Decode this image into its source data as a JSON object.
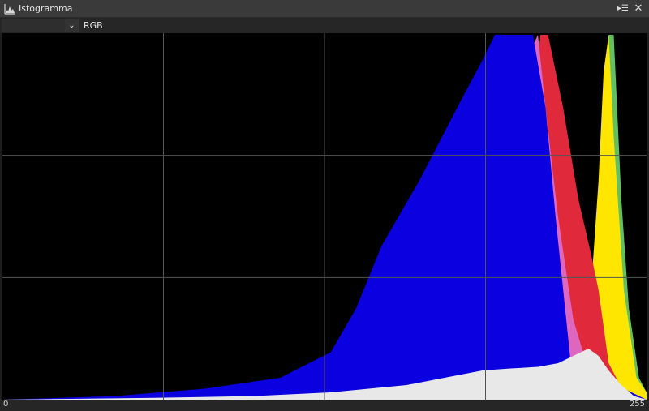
{
  "window": {
    "title": "Istogramma",
    "icon": "histogram-icon",
    "menu_icon": "panel-menu-icon",
    "close_icon": "close-icon"
  },
  "toolbar": {
    "dropdown_icon": "chevron-down-icon",
    "channel_label": "RGB"
  },
  "axis": {
    "min_label": "0",
    "max_label": "255"
  },
  "colors": {
    "background": "#000000",
    "grid": "#555555",
    "blue": "#0a00e0",
    "magenta": "#de66be",
    "red": "#e02a3c",
    "yellow": "#ffe600",
    "green": "#62bf62",
    "cyan": "#22c0e0",
    "luminance": "#e8e8e8"
  },
  "chart_data": {
    "type": "area",
    "x_range": [
      0,
      255
    ],
    "y_range": [
      0,
      1
    ],
    "grid": true,
    "grid_divisions": {
      "x": 4,
      "y": 3
    },
    "legend": "none",
    "series": [
      {
        "color_key": "green",
        "x": [
          0,
          230,
          235,
          238,
          240,
          242,
          245,
          248,
          252,
          255
        ],
        "values": [
          0,
          0,
          0.4,
          0.8,
          1.0,
          1.0,
          0.55,
          0.25,
          0.06,
          0.02
        ]
      },
      {
        "color_key": "yellow",
        "x": [
          0,
          223,
          228,
          233,
          236,
          238,
          240,
          242,
          246,
          251,
          255
        ],
        "values": [
          0,
          0,
          0.1,
          0.3,
          0.6,
          0.9,
          1.0,
          0.72,
          0.3,
          0.06,
          0.02
        ]
      },
      {
        "color_key": "red",
        "x": [
          0,
          195,
          205,
          210,
          213,
          216,
          222,
          228,
          233,
          236,
          240,
          246,
          255
        ],
        "values": [
          0,
          0.02,
          0.4,
          0.8,
          1.0,
          1.0,
          0.8,
          0.55,
          0.4,
          0.3,
          0.1,
          0.02,
          0.0
        ]
      },
      {
        "color_key": "magenta",
        "x": [
          0,
          160,
          180,
          195,
          205,
          210,
          212,
          215,
          220,
          226,
          232,
          240,
          255
        ],
        "values": [
          0,
          0.02,
          0.08,
          0.3,
          0.65,
          0.97,
          1.0,
          0.8,
          0.5,
          0.22,
          0.08,
          0.02,
          0.0
        ]
      },
      {
        "color_key": "blue",
        "x": [
          0,
          45,
          80,
          110,
          130,
          140,
          150,
          165,
          180,
          190,
          195,
          202,
          210,
          215,
          219,
          225,
          255
        ],
        "values": [
          0,
          0.01,
          0.03,
          0.06,
          0.13,
          0.25,
          0.42,
          0.6,
          0.8,
          0.93,
          1.0,
          1.0,
          1.0,
          0.8,
          0.5,
          0.1,
          0.0
        ]
      },
      {
        "color_key": "cyan",
        "x": [
          0,
          120,
          140,
          160,
          175,
          190,
          200,
          210,
          215,
          225,
          255
        ],
        "values": [
          0,
          0.008,
          0.02,
          0.038,
          0.05,
          0.06,
          0.07,
          0.06,
          0.02,
          0.005,
          0.0
        ]
      },
      {
        "color_key": "luminance",
        "x": [
          0,
          60,
          100,
          130,
          160,
          175,
          190,
          200,
          212,
          220,
          226,
          232,
          236,
          240,
          245,
          250,
          255
        ],
        "values": [
          0,
          0.005,
          0.01,
          0.02,
          0.04,
          0.06,
          0.08,
          0.085,
          0.09,
          0.1,
          0.12,
          0.14,
          0.12,
          0.08,
          0.04,
          0.01,
          0.0
        ]
      }
    ]
  }
}
